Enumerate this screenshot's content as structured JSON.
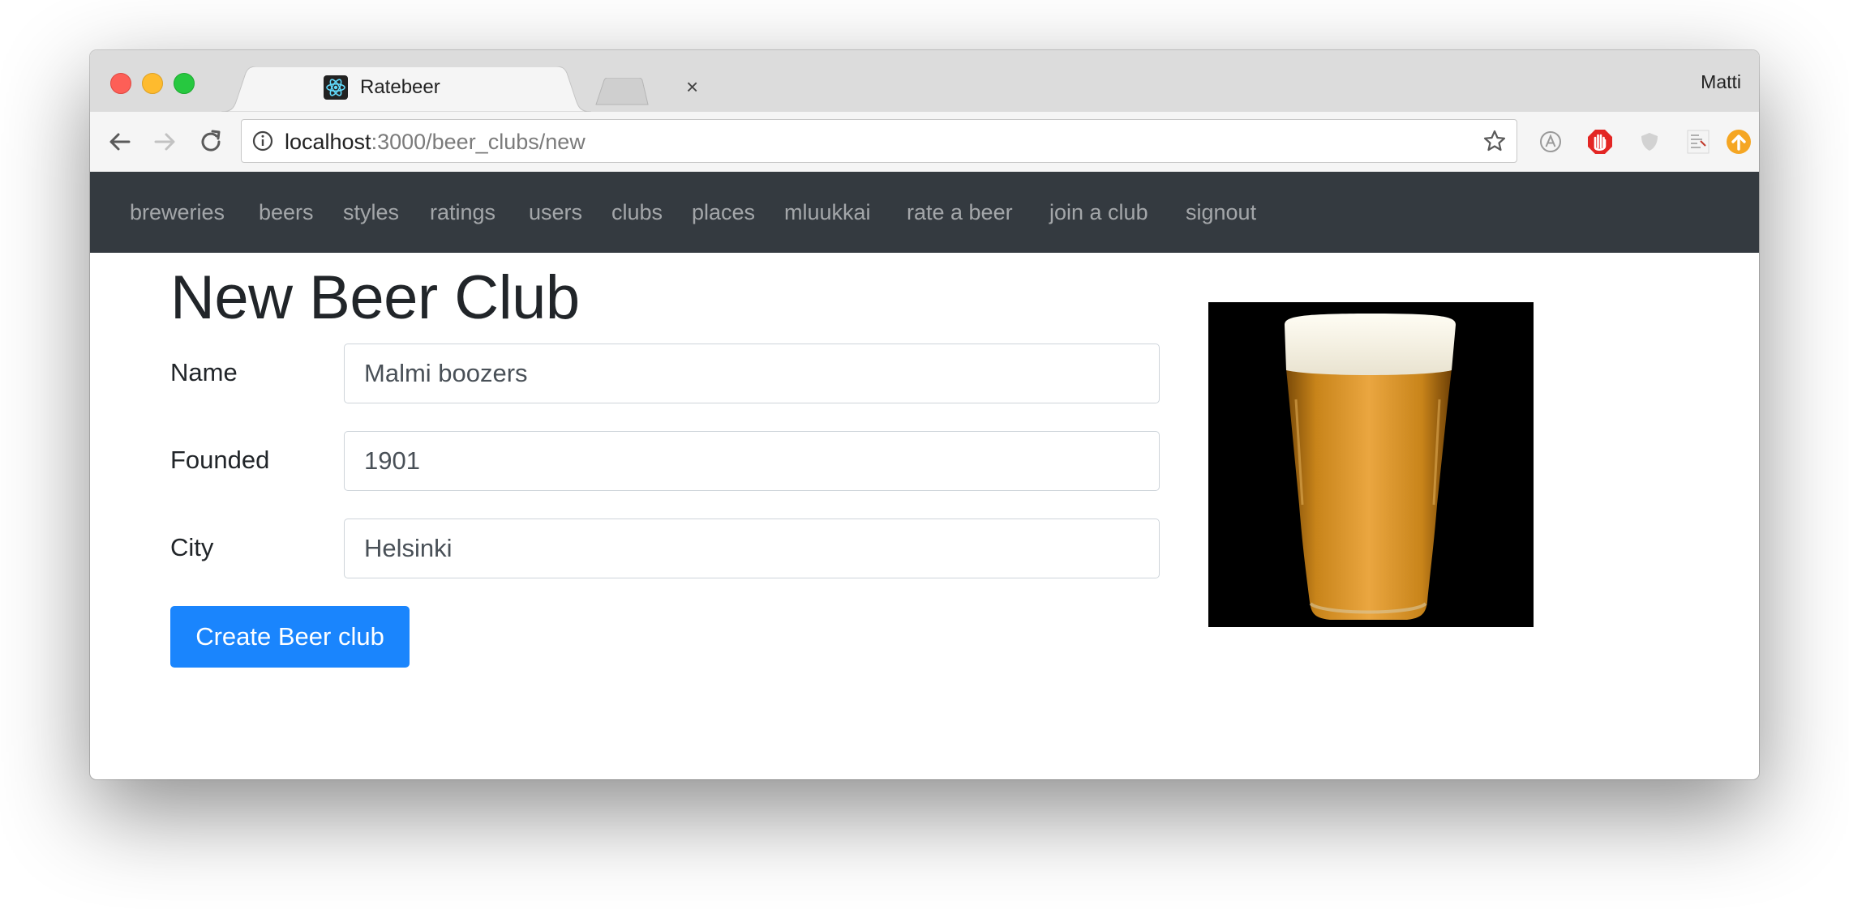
{
  "browser": {
    "tab_title": "Ratebeer",
    "tab_close": "×",
    "profile_name": "Matti",
    "url_host": "localhost",
    "url_path": ":3000/beer_clubs/new"
  },
  "nav": {
    "items": [
      "breweries",
      "beers",
      "styles",
      "ratings",
      "users",
      "clubs",
      "places",
      "mluukkai",
      "rate a beer",
      "join a club",
      "signout"
    ]
  },
  "page": {
    "title": "New Beer Club",
    "fields": [
      {
        "label": "Name",
        "value": "Malmi boozers"
      },
      {
        "label": "Founded",
        "value": "1901"
      },
      {
        "label": "City",
        "value": "Helsinki"
      }
    ],
    "submit_label": "Create Beer club"
  },
  "image": {
    "subject": "beer glass",
    "icon": "beer-glass-image"
  },
  "colors": {
    "navbar_bg": "#343a40",
    "primary_button": "#1a85fd",
    "nav_link": "rgba(255,255,255,0.55)"
  }
}
